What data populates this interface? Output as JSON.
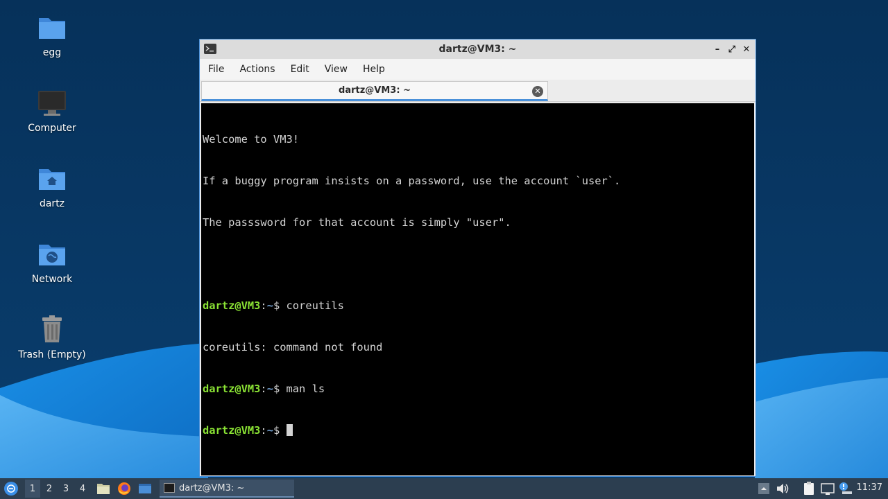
{
  "desktop": {
    "icons": [
      {
        "label": "egg",
        "icon": "folder-icon"
      },
      {
        "label": "Computer",
        "icon": "computer-icon"
      },
      {
        "label": "dartz",
        "icon": "home-folder-icon"
      },
      {
        "label": "Network",
        "icon": "network-folder-icon"
      },
      {
        "label": "Trash (Empty)",
        "icon": "trash-icon"
      }
    ]
  },
  "window": {
    "title": "dartz@VM3: ~",
    "controls": {
      "minimize": "–",
      "maximize": "⤢",
      "close": "✕"
    },
    "menu": [
      "File",
      "Actions",
      "Edit",
      "View",
      "Help"
    ],
    "tab": {
      "label": "dartz@VM3: ~",
      "close": "✕"
    }
  },
  "terminal": {
    "lines": [
      {
        "text": "Welcome to VM3!"
      },
      {
        "text": "If a buggy program insists on a password, use the account `user`."
      },
      {
        "text": "The passsword for that account is simply \"user\"."
      },
      {
        "text": ""
      },
      {
        "user": "dartz@VM3",
        "sep": ":",
        "path": "~",
        "dollar": "$ ",
        "cmd": "coreutils"
      },
      {
        "text": "coreutils: command not found"
      },
      {
        "user": "dartz@VM3",
        "sep": ":",
        "path": "~",
        "dollar": "$ ",
        "cmd": "man ls"
      },
      {
        "user": "dartz@VM3",
        "sep": ":",
        "path": "~",
        "dollar": "$ ",
        "cmd": ""
      }
    ]
  },
  "taskbar": {
    "workspaces": [
      "1",
      "2",
      "3",
      "4"
    ],
    "active_workspace": "1",
    "task": {
      "label": "dartz@VM3: ~"
    },
    "clock": "11:37"
  },
  "colors": {
    "prompt_user": "#8ae234",
    "prompt_path": "#729fcf",
    "terminal_bg": "#000000",
    "terminal_fg": "#d3d3d3",
    "accent": "#4a90d9"
  }
}
